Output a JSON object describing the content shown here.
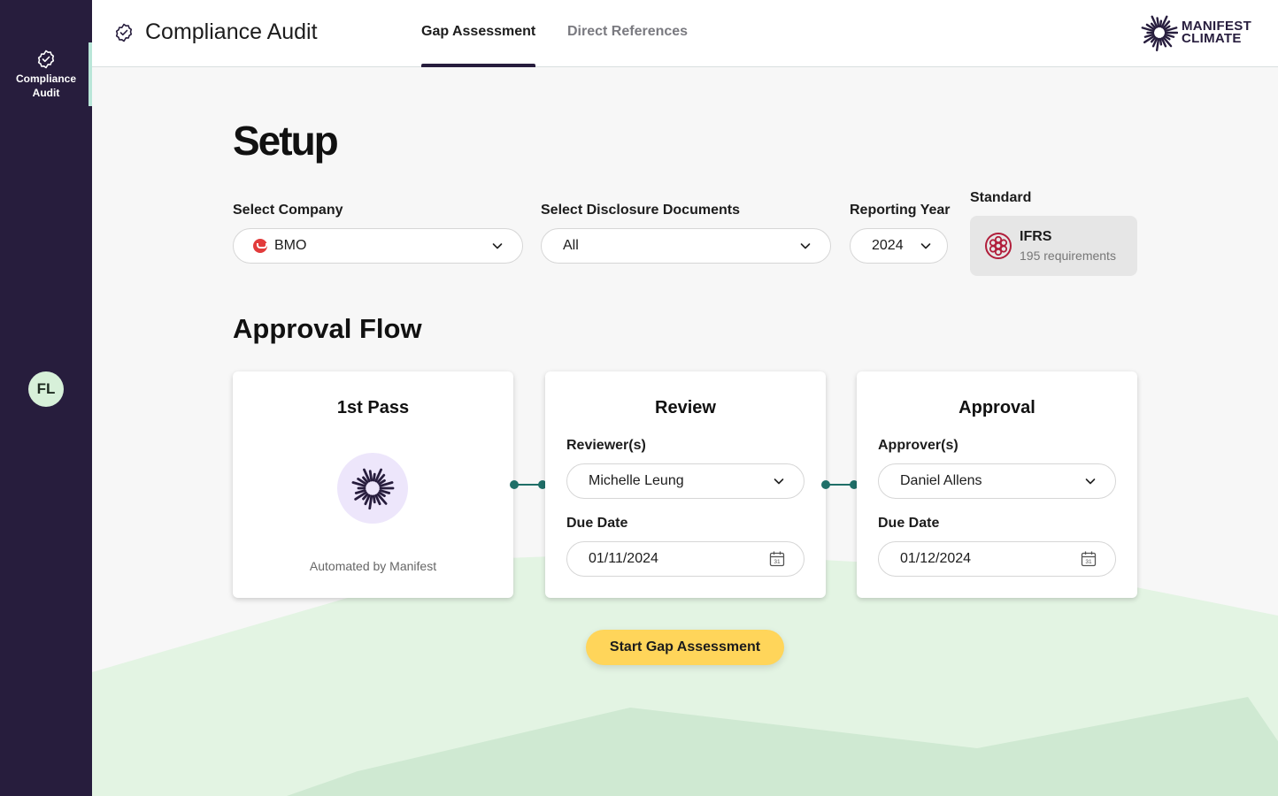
{
  "sidebar": {
    "items": [
      {
        "label": "Compliance Audit",
        "icon": "badge-check-icon"
      }
    ],
    "avatar_initials": "FL"
  },
  "header": {
    "title": "Compliance Audit",
    "tabs": [
      {
        "label": "Gap Assessment",
        "active": true
      },
      {
        "label": "Direct References",
        "active": false
      }
    ],
    "logo_line1": "MANIFEST",
    "logo_line2": "CLIMATE"
  },
  "setup": {
    "heading": "Setup",
    "company": {
      "label": "Select Company",
      "value": "BMO",
      "icon": "bmo-logo-icon"
    },
    "documents": {
      "label": "Select Disclosure Documents",
      "value": "All"
    },
    "year": {
      "label": "Reporting Year",
      "value": "2024"
    },
    "standard": {
      "label": "Standard",
      "name": "IFRS",
      "requirements": "195 requirements",
      "icon": "ifrs-logo-icon"
    }
  },
  "approval": {
    "heading": "Approval Flow",
    "first_pass": {
      "title": "1st Pass",
      "note": "Automated by Manifest"
    },
    "review": {
      "title": "Review",
      "people_label": "Reviewer(s)",
      "person": "Michelle Leung",
      "date_label": "Due Date",
      "date": "01/11/2024"
    },
    "approve": {
      "title": "Approval",
      "people_label": "Approver(s)",
      "person": "Daniel Allens",
      "date_label": "Due Date",
      "date": "01/12/2024"
    }
  },
  "actions": {
    "start_label": "Start Gap Assessment"
  },
  "colors": {
    "sidebar": "#271d3d",
    "accent": "#ffd55a",
    "connector": "#1f6f68",
    "hill_light": "#e3f4e3",
    "hill_dark": "#cfe9d2"
  }
}
